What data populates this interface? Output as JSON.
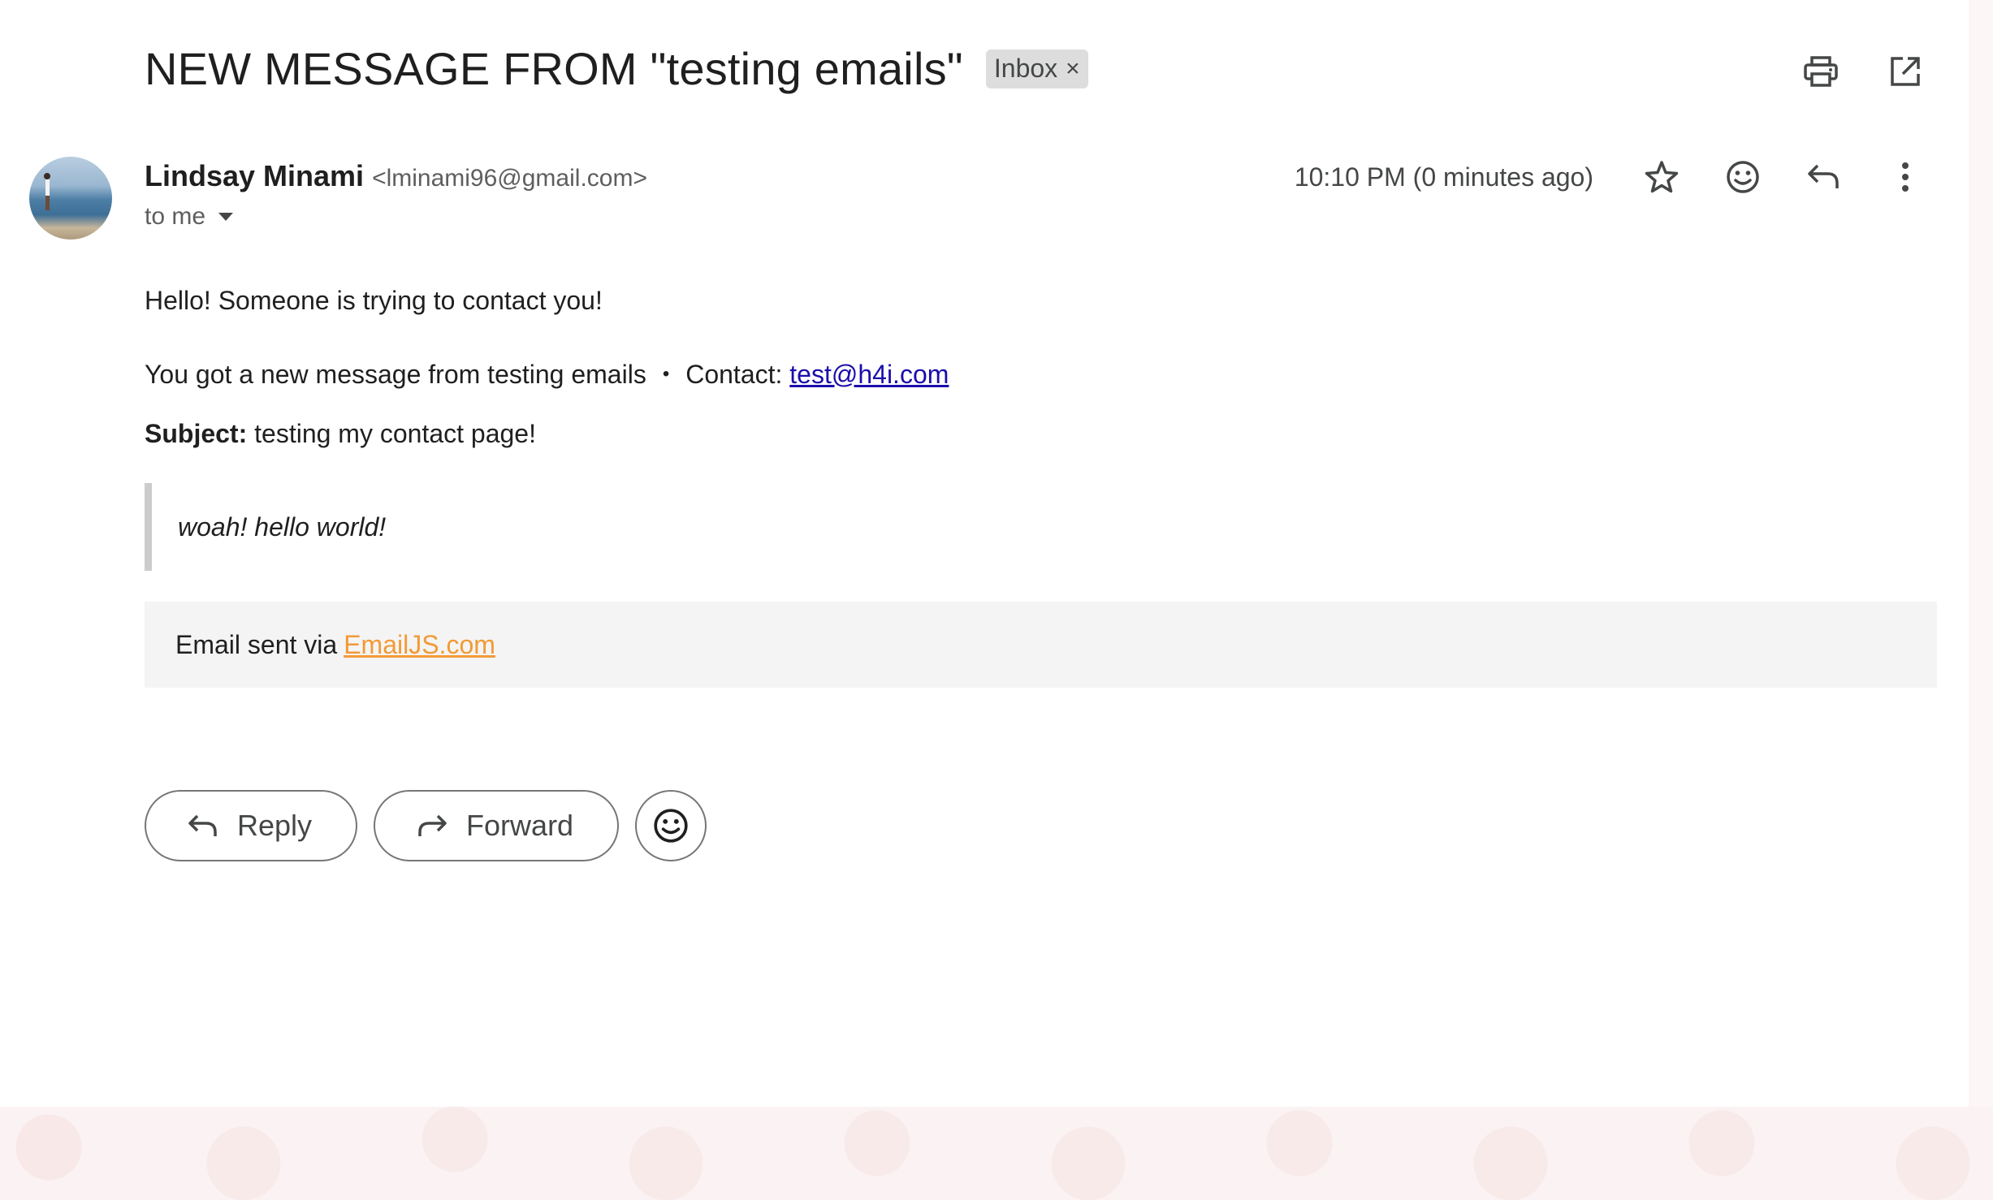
{
  "subject": "NEW MESSAGE FROM \"testing emails\"",
  "label_chip": {
    "text": "Inbox",
    "remove": "×"
  },
  "sender": {
    "name": "Lindsay Minami",
    "email": "<lminami96@gmail.com>",
    "to_line": "to me"
  },
  "timestamp": "10:10 PM (0 minutes ago)",
  "body": {
    "greeting": "Hello! Someone is trying to contact you!",
    "message_prefix": "You got a new message from testing emails",
    "dot": "•",
    "contact_label": "Contact:",
    "contact_email": "test@h4i.com",
    "subject_label": "Subject:",
    "subject_value": "testing my contact page!",
    "quote": "woah! hello world!",
    "footer_prefix": "Email sent via",
    "footer_link": "EmailJS.com"
  },
  "actions": {
    "reply": "Reply",
    "forward": "Forward"
  },
  "icons": {
    "top": [
      "print-icon",
      "open-in-new-window-icon"
    ],
    "meta": [
      "star-icon",
      "emoji-reaction-icon",
      "reply-icon",
      "more-vert-icon"
    ]
  },
  "colors": {
    "link_blue": "#1a0dab",
    "link_orange": "#f29a37",
    "chip_bg": "#dddddd",
    "quote_border": "#cccccc"
  }
}
